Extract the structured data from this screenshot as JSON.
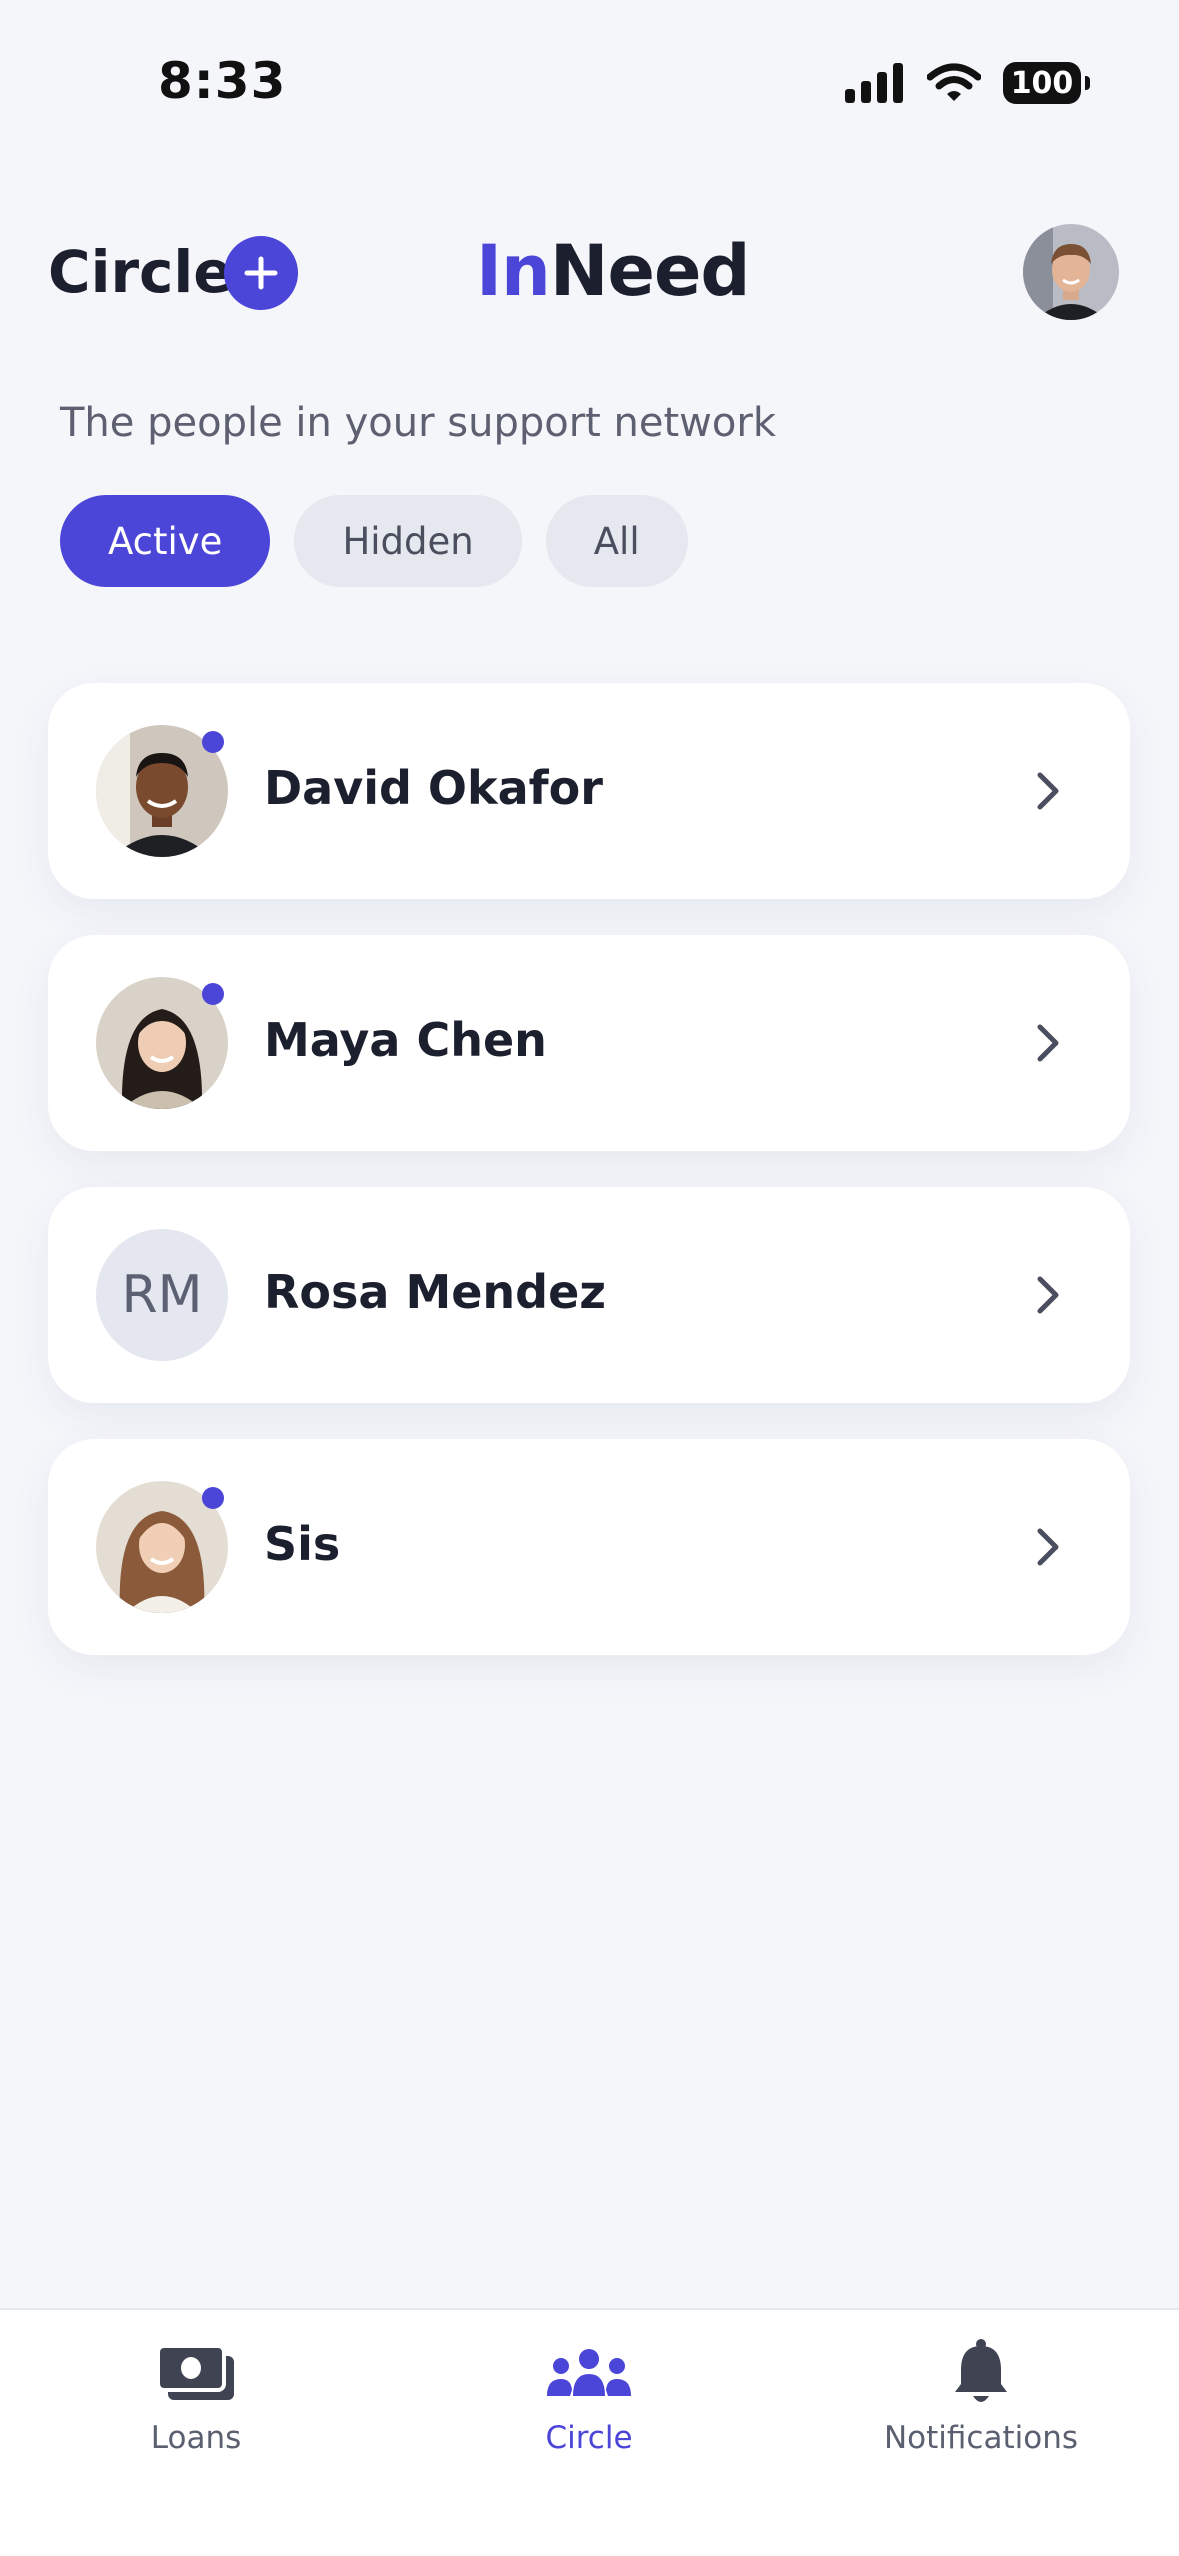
{
  "status_bar": {
    "time": "8:33",
    "battery": "100"
  },
  "header": {
    "title": "Circle",
    "logo_accent": "In",
    "logo_rest": "Need"
  },
  "subtitle": "The people in your support network",
  "filters": [
    {
      "label": "Active",
      "selected": true
    },
    {
      "label": "Hidden",
      "selected": false
    },
    {
      "label": "All",
      "selected": false
    }
  ],
  "people": [
    {
      "name": "David Okafor",
      "avatar": "photo",
      "online": true
    },
    {
      "name": "Maya Chen",
      "avatar": "photo",
      "online": true
    },
    {
      "name": "Rosa Mendez",
      "avatar": "initials",
      "initials": "RM",
      "online": false
    },
    {
      "name": "Sis",
      "avatar": "photo",
      "online": true
    }
  ],
  "tabs": [
    {
      "label": "Loans",
      "icon": "money-icon",
      "active": false
    },
    {
      "label": "Circle",
      "icon": "group-icon",
      "active": true
    },
    {
      "label": "Notifications",
      "icon": "bell-icon",
      "active": false
    }
  ],
  "colors": {
    "accent": "#4b45d8",
    "background": "#f5f6fa",
    "text": "#1c1f2e"
  }
}
